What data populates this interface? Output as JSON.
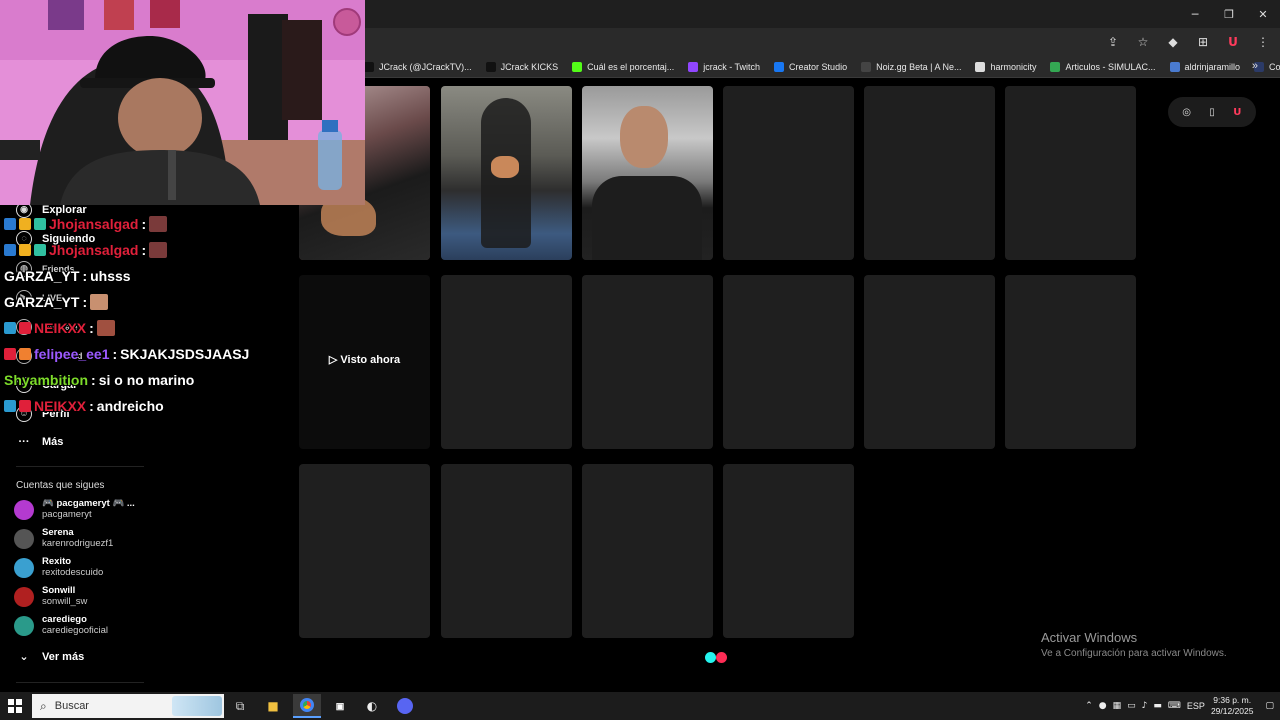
{
  "window": {
    "minimize": "─",
    "restore": "❐",
    "close": "✕"
  },
  "address_icons": [
    "⇪",
    "☆",
    "◆",
    "⊞",
    "U",
    "⋮"
  ],
  "bookmarks": [
    {
      "label": "JCrack (@JCrackTV)...",
      "color": "#111111"
    },
    {
      "label": "JCrack KICKS",
      "color": "#111111"
    },
    {
      "label": "Cuál es el porcentaj...",
      "color": "#53fc18"
    },
    {
      "label": "jcrack - Twitch",
      "color": "#9146ff"
    },
    {
      "label": "Creator Studio",
      "color": "#1877f2"
    },
    {
      "label": "Noiz.gg Beta | A Ne...",
      "color": "#444444"
    },
    {
      "label": "harmonicity",
      "color": "#dddddd"
    },
    {
      "label": "Articulos - SIMULAC...",
      "color": "#34a853"
    },
    {
      "label": "aldrinjaramillo",
      "color": "#4a7bd0"
    },
    {
      "label": "Colección de M_blei...",
      "color": "#2b3a67"
    }
  ],
  "bookmarks_more": "»",
  "nav": {
    "explorar": "Explorar",
    "siguiendo": "Siguiendo",
    "friends": "Friends",
    "live": "LIVE",
    "mensajes": "Mensajes",
    "actividad": "Actividad",
    "cargar": "Cargar",
    "perfil": "Perfil",
    "mas": "Más"
  },
  "following": {
    "title": "Cuentas que sigues",
    "accounts": [
      {
        "name": "🎮 pacgameryt 🎮 ...",
        "handle": "pacgameryt",
        "color": "#b43ad0"
      },
      {
        "name": "Serena",
        "handle": "karenrodriguezf1",
        "color": "#555555"
      },
      {
        "name": "Rexito",
        "handle": "rexitodescuido",
        "color": "#3aa0d0"
      },
      {
        "name": "Sonwill",
        "handle": "sonwill_sw",
        "color": "#b02020"
      },
      {
        "name": "carediego",
        "handle": "carediegooficial",
        "color": "#2a9a8a"
      }
    ],
    "see_more": "Ver más"
  },
  "grid": {
    "watched_label": "▷ Visto ahora"
  },
  "toolbar_icons": [
    "◎",
    "▯",
    "U"
  ],
  "chat": [
    {
      "user": "Jhojansalgad",
      "msg": "",
      "color": "#e0203a"
    },
    {
      "user": "Jhojansalgad",
      "msg": "",
      "color": "#e0203a"
    },
    {
      "user": "GARZA_YT",
      "msg": "uhsss",
      "color": "#ffffff"
    },
    {
      "user": "GARZA_YT",
      "msg": "",
      "color": "#ffffff"
    },
    {
      "user": "NEIKXX",
      "msg": "",
      "color": "#e0203a"
    },
    {
      "user": "felipee_ee1",
      "msg": "SKJAKJSDSJAASJ",
      "color": "#9b59ff"
    },
    {
      "user": "Shyambition",
      "msg": "si o no marino",
      "color": "#7ddc2a"
    },
    {
      "user": "NEIKXX",
      "msg": "andreicho",
      "color": "#e0203a"
    }
  ],
  "watermark": {
    "line1": "Activar Windows",
    "line2": "Ve a Configuración para activar Windows."
  },
  "taskbar": {
    "search_placeholder": "Buscar",
    "lang": "ESP",
    "time": "9:36 p. m.",
    "date": "29/12/2025"
  }
}
